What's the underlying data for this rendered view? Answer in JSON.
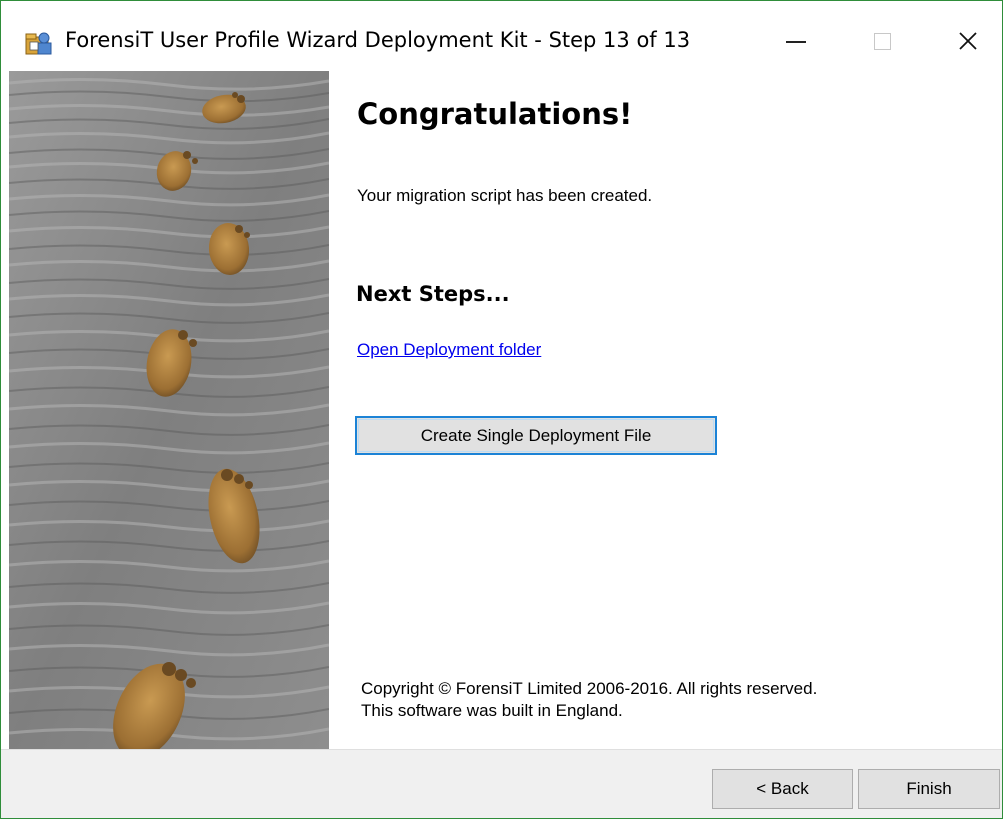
{
  "window": {
    "title": "ForensiT User Profile Wizard Deployment Kit - Step 13 of 13",
    "app_icon": "app-icon",
    "controls": {
      "minimize": "minimize-icon",
      "maximize": "maximize-icon",
      "close": "close-icon"
    }
  },
  "side_image": {
    "description_icon": "footprints-in-sand-image"
  },
  "content": {
    "heading": "Congratulations!",
    "message": "Your migration script has been created.",
    "next_steps_heading": "Next Steps...",
    "open_folder_link": "Open Deployment folder",
    "create_file_button": "Create Single Deployment File",
    "copyright_line1": "Copyright © ForensiT Limited 2006-2016. All rights reserved.",
    "copyright_line2": "This software was built in England."
  },
  "footer": {
    "back_button": "< Back",
    "finish_button": "Finish"
  },
  "colors": {
    "window_border": "#2f8d3a",
    "link": "#0000ee",
    "focus_border": "#1c83d6",
    "button_face": "#e1e1e1",
    "footer_bg": "#f0f0f0"
  }
}
